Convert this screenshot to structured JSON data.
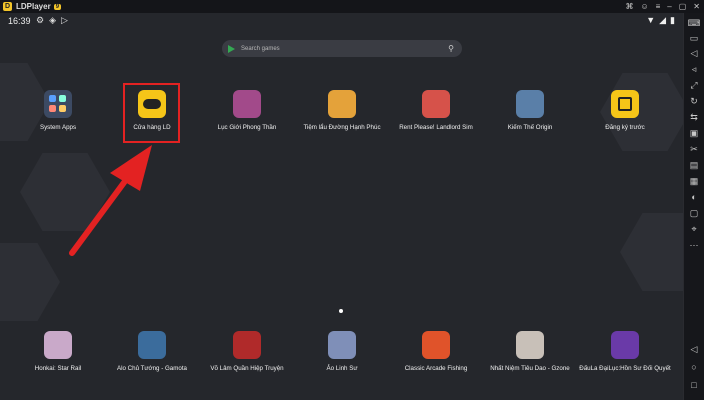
{
  "titlebar": {
    "title": "LDPlayer",
    "badge": "9",
    "logo_glyph": "D"
  },
  "status": {
    "time": "16:39"
  },
  "search": {
    "placeholder": "Search games"
  },
  "apps_top": [
    {
      "label": "System Apps",
      "icon": "folder-icon",
      "color": "#3c4a63"
    },
    {
      "label": "Cửa hàng LD",
      "icon": "gamepad-icon",
      "color": "#f5c518"
    },
    {
      "label": "Lục Giới Phong Thần",
      "icon": "game-art-icon",
      "color": "#a24a8a"
    },
    {
      "label": "Tiệm lẩu Đường Hạnh Phúc",
      "icon": "hotpot-icon",
      "color": "#e4a23a"
    },
    {
      "label": "Rent Please! Landlord Sim",
      "icon": "character-icon",
      "color": "#d6524a"
    },
    {
      "label": "Kiếm Thế Origin",
      "icon": "warrior-icon",
      "color": "#5a7fa8"
    },
    {
      "label": "Đăng ký trước",
      "icon": "calendar-icon",
      "color": "#f5c518"
    }
  ],
  "apps_bottom": [
    {
      "label": "Honkai: Star Rail",
      "icon": "game-art-icon",
      "color": "#c9a9c9"
    },
    {
      "label": "Alo Chủ Tướng - Gamota",
      "icon": "game-art-icon",
      "color": "#3b6c9c"
    },
    {
      "label": "Võ Lâm Quần Hiệp Truyện",
      "icon": "game-art-icon",
      "color": "#b02a2a"
    },
    {
      "label": "Ảo Linh Sư",
      "icon": "game-art-icon",
      "color": "#7f8fb8"
    },
    {
      "label": "Classic Arcade Fishing",
      "icon": "fishing-icon",
      "color": "#e0532a"
    },
    {
      "label": "Nhất Niệm Tiêu Dao - Gzone",
      "icon": "game-art-icon",
      "color": "#c8c0b8"
    },
    {
      "label": "ĐấuLa ĐạiLục:Hồn Sư Đối Quyết",
      "icon": "game-art-icon",
      "color": "#6a3aa8"
    }
  ],
  "accent": "#e32222"
}
